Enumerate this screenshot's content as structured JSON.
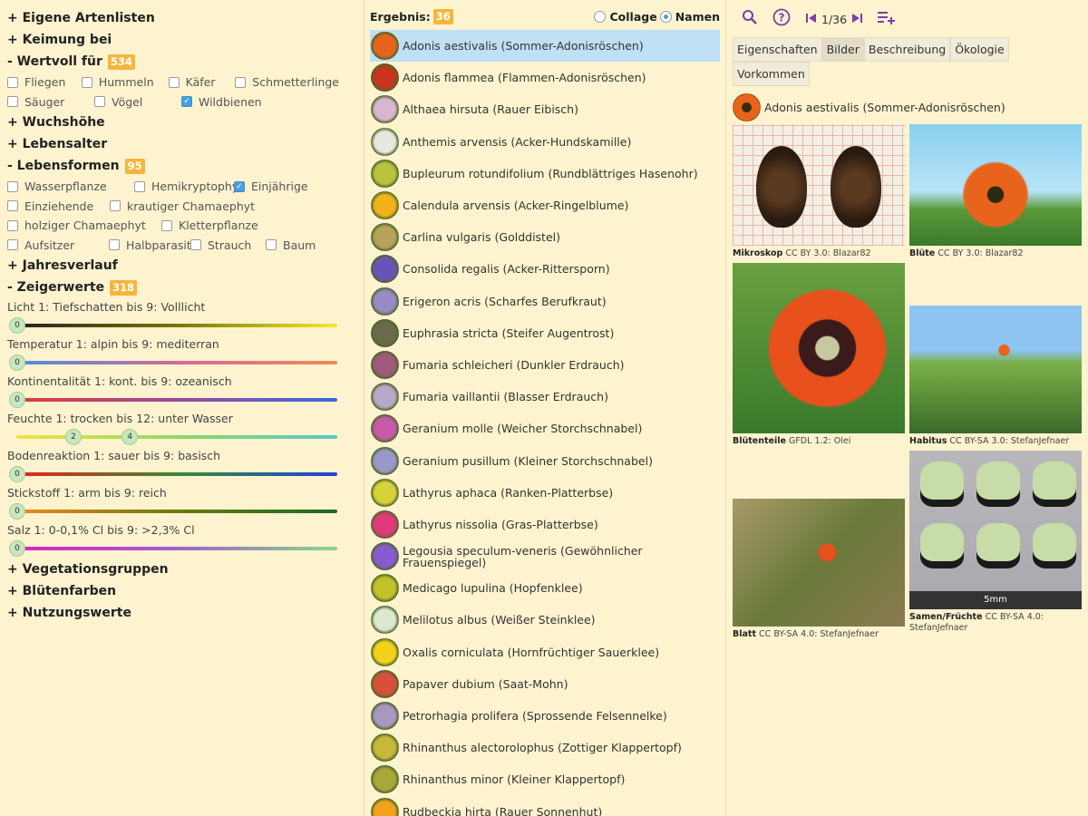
{
  "left": {
    "sections": {
      "eigene": "+ Eigene Artenlisten",
      "keimung": "+ Keimung bei",
      "wertvoll": "- Wertvoll für",
      "wertvoll_count": "534",
      "wuchshoehe": "+ Wuchshöhe",
      "lebensalter": "+ Lebensalter",
      "lebensformen": "- Lebensformen",
      "lebensformen_count": "95",
      "jahresverlauf": "+ Jahresverlauf",
      "zeigerwerte": "- Zeigerwerte",
      "zeigerwerte_count": "318",
      "vegetation": "+ Vegetationsgruppen",
      "bluetenfarben": "+ Blütenfarben",
      "nutzung": "+ Nutzungswerte"
    },
    "wertvoll_items": [
      {
        "label": "Fliegen",
        "checked": false
      },
      {
        "label": "Hummeln",
        "checked": false
      },
      {
        "label": "Käfer",
        "checked": false
      },
      {
        "label": "Schmetterlinge",
        "checked": false
      },
      {
        "label": "Säuger",
        "checked": false
      },
      {
        "label": "Vögel",
        "checked": false
      },
      {
        "label": "Wildbienen",
        "checked": true
      }
    ],
    "lebensformen_items": [
      {
        "label": "Wasserpflanze",
        "checked": false
      },
      {
        "label": "Hemikryptophyt",
        "checked": false
      },
      {
        "label": "Einjährige",
        "checked": true
      },
      {
        "label": "Einziehende",
        "checked": false
      },
      {
        "label": "krautiger Chamaephyt",
        "checked": false
      },
      {
        "label": "holziger Chamaephyt",
        "checked": false
      },
      {
        "label": "Kletterpflanze",
        "checked": false
      },
      {
        "label": "Aufsitzer",
        "checked": false
      },
      {
        "label": "Halbparasit",
        "checked": false
      },
      {
        "label": "Strauch",
        "checked": false
      },
      {
        "label": "Baum",
        "checked": false
      }
    ],
    "zeiger": [
      {
        "label": "Licht 1: Tiefschatten bis 9: Volllicht",
        "knobs": [
          "0"
        ],
        "gradient": "linear-gradient(90deg,#222,#7d7300,#f2ea2a)",
        "level": [
          0
        ]
      },
      {
        "label": "Temperatur 1: alpin bis 9: mediterran",
        "knobs": [
          "0"
        ],
        "gradient": "linear-gradient(90deg,#4a8fe0,#d36a9a,#f08a5a)",
        "level": [
          0
        ]
      },
      {
        "label": "Kontinentalität 1: kont. bis 9: ozeanisch",
        "knobs": [
          "0"
        ],
        "gradient": "linear-gradient(90deg,#e23a3a,#9b4aa0,#3a6ad8)",
        "level": [
          0
        ]
      },
      {
        "label": "Feuchte 1: trocken bis 12: unter Wasser",
        "knobs": [
          "2",
          "4"
        ],
        "gradient": "linear-gradient(90deg,#f2e23a,#8fd86a,#59c8c8)",
        "level": [
          0.176,
          0.353
        ]
      },
      {
        "label": "Bodenreaktion 1: sauer bis 9: basisch",
        "knobs": [
          "0"
        ],
        "gradient": "linear-gradient(90deg,#e82020,#3a8a30,#2040e0)",
        "level": [
          0
        ]
      },
      {
        "label": "Stickstoff 1: arm bis 9: reich",
        "knobs": [
          "0"
        ],
        "gradient": "linear-gradient(90deg,#f08a1a,#6a7a10,#1a6a20)",
        "level": [
          0
        ]
      },
      {
        "label": "Salz 1: 0-0,1% Cl bis 9: >2,3% Cl",
        "knobs": [
          "0"
        ],
        "gradient": "linear-gradient(90deg,#e020c0,#a060d0,#8ad88a)",
        "level": [
          0
        ]
      }
    ]
  },
  "mid": {
    "result_label": "Ergebnis:",
    "result_count": "36",
    "collage": "Collage",
    "namen": "Namen",
    "species": [
      {
        "name": "Adonis aestivalis (Sommer-Adonisröschen)",
        "color": "#e8641c"
      },
      {
        "name": "Adonis flammea (Flammen-Adonisröschen)",
        "color": "#c8321e"
      },
      {
        "name": "Althaea hirsuta (Rauer Eibisch)",
        "color": "#d9b6cf"
      },
      {
        "name": "Anthemis arvensis (Acker-Hundskamille)",
        "color": "#e8e8e0"
      },
      {
        "name": "Bupleurum rotundifolium (Rundblättriges Hasenohr)",
        "color": "#b8c23a"
      },
      {
        "name": "Calendula arvensis (Acker-Ringelblume)",
        "color": "#f2b21a"
      },
      {
        "name": "Carlina vulgaris (Golddistel)",
        "color": "#b8a25a"
      },
      {
        "name": "Consolida regalis (Acker-Rittersporn)",
        "color": "#6a52b8"
      },
      {
        "name": "Erigeron acris (Scharfes Berufkraut)",
        "color": "#9a8ac8"
      },
      {
        "name": "Euphrasia stricta (Steifer Augentrost)",
        "color": "#6a6a4a"
      },
      {
        "name": "Fumaria schleicheri (Dunkler Erdrauch)",
        "color": "#a05a7a"
      },
      {
        "name": "Fumaria vaillantii (Blasser Erdrauch)",
        "color": "#b8a8c8"
      },
      {
        "name": "Geranium molle (Weicher Storchschnabel)",
        "color": "#c85aa8"
      },
      {
        "name": "Geranium pusillum (Kleiner Storchschnabel)",
        "color": "#9a98c8"
      },
      {
        "name": "Lathyrus aphaca (Ranken-Platterbse)",
        "color": "#d8d23a"
      },
      {
        "name": "Lathyrus nissolia (Gras-Platterbse)",
        "color": "#e03a7a"
      },
      {
        "name": "Legousia speculum-veneris (Gewöhnlicher Frauenspiegel)",
        "color": "#8a5ad0"
      },
      {
        "name": "Medicago lupulina (Hopfenklee)",
        "color": "#c2c22a"
      },
      {
        "name": "Melilotus albus (Weißer Steinklee)",
        "color": "#dce8d0"
      },
      {
        "name": "Oxalis corniculata (Hornfrüchtiger Sauerklee)",
        "color": "#f2d21a"
      },
      {
        "name": "Papaver dubium (Saat-Mohn)",
        "color": "#d8503a"
      },
      {
        "name": "Petrorhagia prolifera (Sprossende Felsennelke)",
        "color": "#a898c0"
      },
      {
        "name": "Rhinanthus alectorolophus (Zottiger Klappertopf)",
        "color": "#c8b83a"
      },
      {
        "name": "Rhinanthus minor (Kleiner Klappertopf)",
        "color": "#a8a83a"
      },
      {
        "name": "Rudbeckia hirta (Rauer Sonnenhut)",
        "color": "#f2a21a"
      }
    ]
  },
  "right": {
    "counter": "1/36",
    "tabs": [
      "Eigenschaften",
      "Bilder",
      "Beschreibung",
      "Ökologie",
      "Vorkommen"
    ],
    "active_tab": "Bilder",
    "species_title": "Adonis aestivalis (Sommer-Adonisröschen)",
    "images": [
      {
        "label": "Mikroskop",
        "credit": "CC BY 3.0: Blazar82"
      },
      {
        "label": "Blüte",
        "credit": "CC BY 3.0: Blazar82"
      },
      {
        "label": "Blütenteile",
        "credit": "GFDL 1.2: Olei"
      },
      {
        "label": "Habitus",
        "credit": "CC BY-SA 3.0: StefanJefnaer"
      },
      {
        "label": "Blatt",
        "credit": "CC BY-SA 4.0: StefanJefnaer"
      },
      {
        "label": "Samen/Früchte",
        "credit": "CC BY-SA 4.0: StefanJefnaer"
      }
    ],
    "scale_label": "5mm"
  },
  "colors": {
    "accent": "#f4b63d",
    "selection": "#bfe0f5",
    "icon": "#7a3fa8",
    "background": "#fdf3cf"
  }
}
